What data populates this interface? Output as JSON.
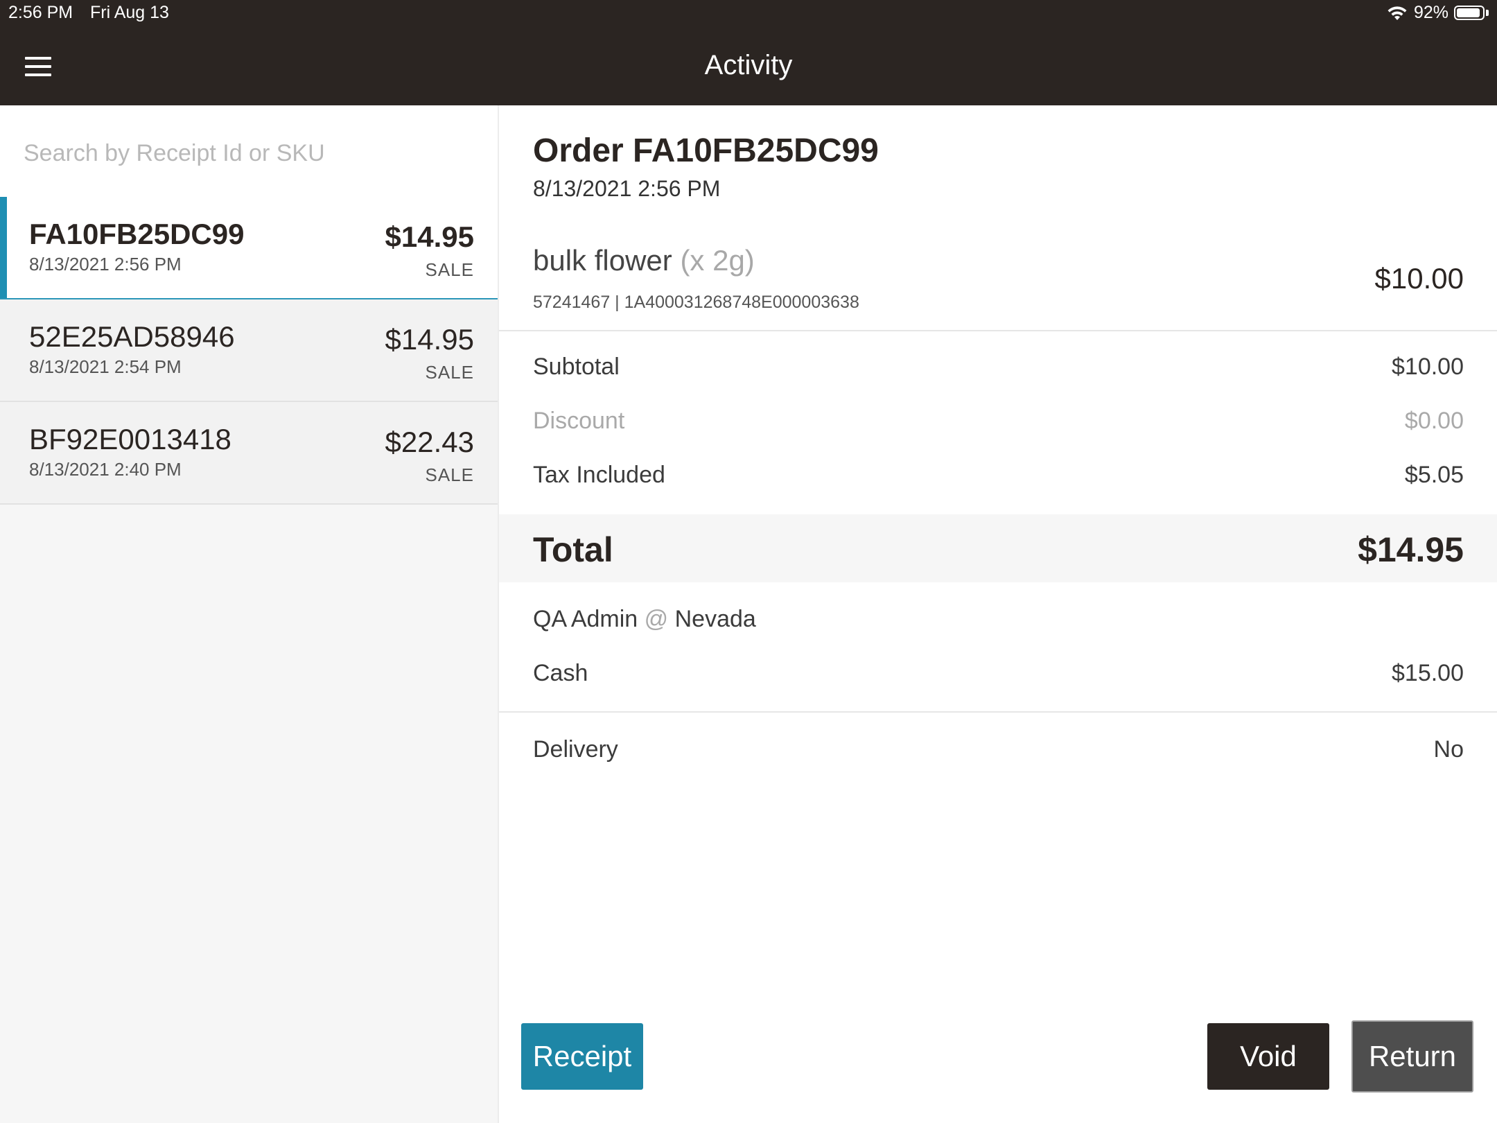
{
  "status_bar": {
    "time": "2:56 PM",
    "date": "Fri Aug 13",
    "battery": "92%",
    "battery_level": 0.92
  },
  "header": {
    "title": "Activity"
  },
  "search": {
    "placeholder": "Search by Receipt Id or SKU",
    "value": ""
  },
  "receipts": [
    {
      "id": "FA10FB25DC99",
      "datetime": "8/13/2021 2:56 PM",
      "amount": "$14.95",
      "type": "SALE",
      "selected": true
    },
    {
      "id": "52E25AD58946",
      "datetime": "8/13/2021 2:54 PM",
      "amount": "$14.95",
      "type": "SALE",
      "selected": false
    },
    {
      "id": "BF92E0013418",
      "datetime": "8/13/2021 2:40 PM",
      "amount": "$22.43",
      "type": "SALE",
      "selected": false
    }
  ],
  "order": {
    "title": "Order FA10FB25DC99",
    "datetime": "8/13/2021 2:56 PM",
    "item": {
      "name": "bulk flower",
      "qty": "(x 2g)",
      "meta": "57241467 | 1A400031268748E000003638",
      "price": "$10.00"
    },
    "subtotal_label": "Subtotal",
    "subtotal": "$10.00",
    "discount_label": "Discount",
    "discount": "$0.00",
    "tax_label": "Tax Included",
    "tax": "$5.05",
    "total_label": "Total",
    "total": "$14.95",
    "employee": "QA Admin",
    "at": "@",
    "location": "Nevada",
    "payment_label": "Cash",
    "payment": "$15.00",
    "delivery_label": "Delivery",
    "delivery": "No"
  },
  "buttons": {
    "receipt": "Receipt",
    "void": "Void",
    "return": "Return"
  },
  "colors": {
    "header_bg": "#2b2522",
    "accent": "#1e86a6",
    "void_bg": "#2b2522",
    "return_bg": "#4e4e4e"
  }
}
